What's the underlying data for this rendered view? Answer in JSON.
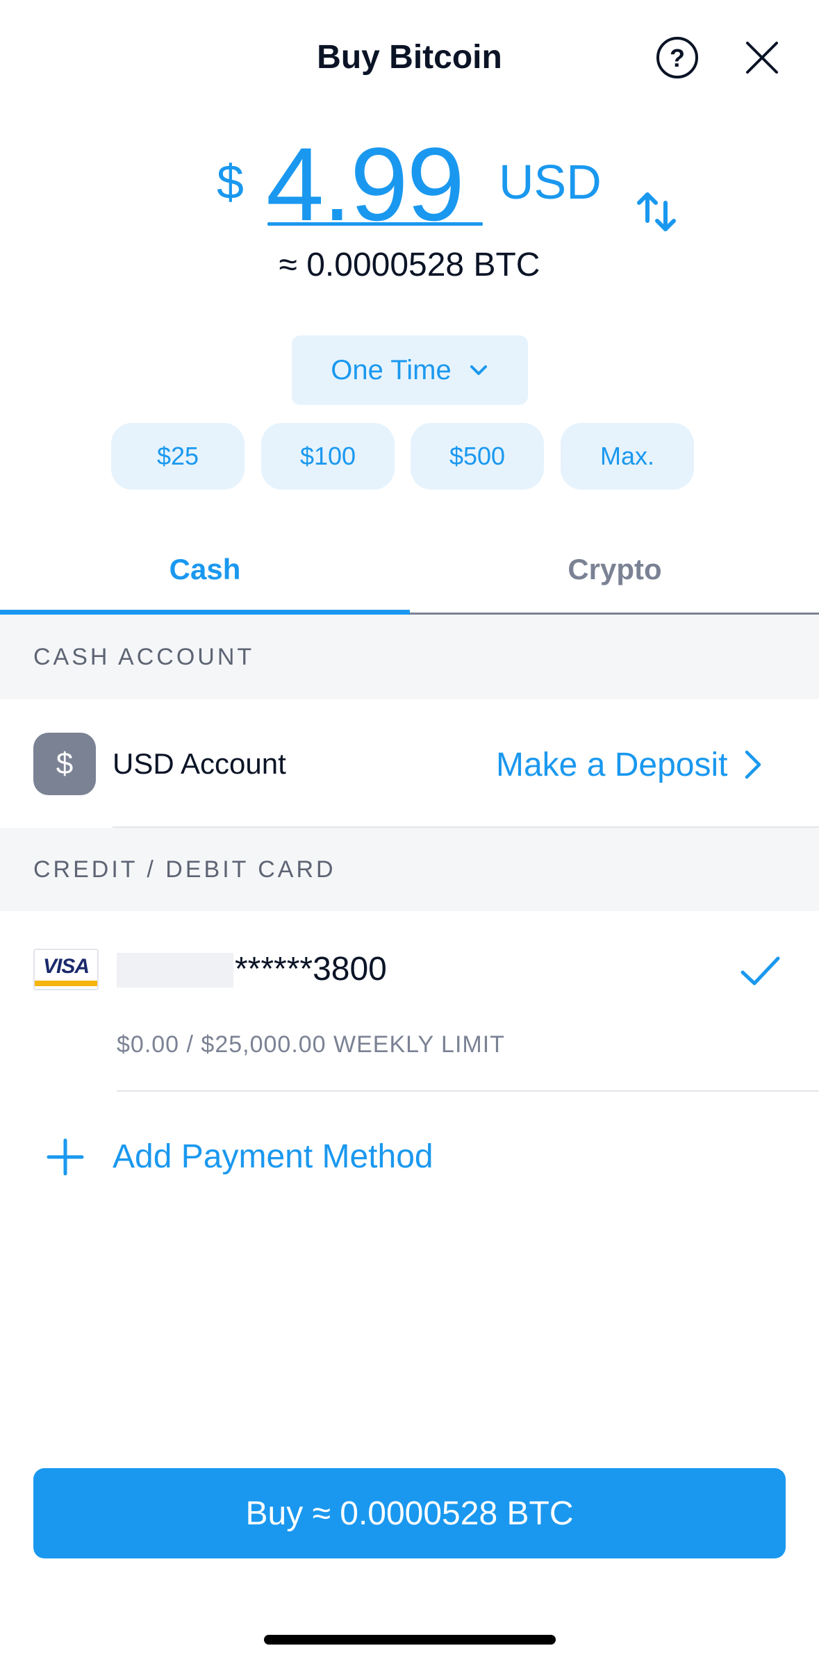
{
  "header": {
    "title": "Buy Bitcoin",
    "help_icon": "question-circle-icon",
    "close_icon": "close-icon"
  },
  "amount": {
    "currency_symbol": "$",
    "value": "4.99",
    "currency_code": "USD",
    "swap_icon": "swap-arrows-icon",
    "crypto_equivalent": "≈ 0.0000528 BTC"
  },
  "frequency": {
    "selected": "One Time",
    "icon": "chevron-down-icon"
  },
  "quick_amounts": [
    "$25",
    "$100",
    "$500",
    "Max."
  ],
  "tabs": {
    "cash": "Cash",
    "crypto": "Crypto",
    "active": "cash"
  },
  "cash_account": {
    "section_title": "CASH ACCOUNT",
    "icon_glyph": "$",
    "account_label": "USD Account",
    "deposit_label": "Make a Deposit"
  },
  "card_section": {
    "section_title": "CREDIT / DEBIT CARD",
    "brand": "VISA",
    "masked_number": "******3800",
    "limit_text": "$0.00 / $25,000.00 WEEKLY LIMIT",
    "selected": true
  },
  "add_payment": {
    "label": "Add Payment Method",
    "icon": "plus-icon"
  },
  "buy_button": {
    "label": "Buy ≈ 0.0000528 BTC"
  },
  "colors": {
    "accent": "#1a98ef",
    "accent_light": "#e6f3fd",
    "text_dark": "#0b1426",
    "text_muted": "#7b8294",
    "section_bg": "#f5f6f8"
  }
}
